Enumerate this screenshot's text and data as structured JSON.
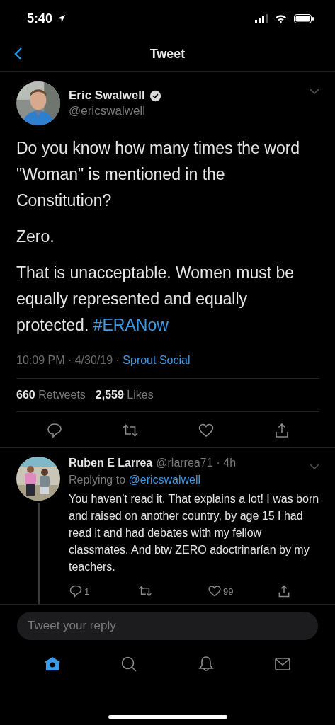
{
  "status_bar": {
    "time": "5:40"
  },
  "nav": {
    "title": "Tweet"
  },
  "tweet": {
    "author": "Eric Swalwell",
    "verified": true,
    "handle": "@ericswalwell",
    "paragraphs": [
      {
        "text": "Do you know how many times the word \"Woman\" is mentioned in the Constitution?"
      },
      {
        "text": "Zero."
      },
      {
        "text": "That is unacceptable. Women must be equally represented and equally protected.",
        "hashtag": "#ERANow"
      }
    ],
    "time": "10:09 PM · 4/30/19 · ",
    "source": "Sprout Social",
    "retweets": "660",
    "retweets_label": "Retweets",
    "likes": "2,559",
    "likes_label": "Likes"
  },
  "reply": {
    "author": "Ruben E Larrea",
    "handle": "@rlarrea71",
    "age": "· 4h",
    "replying_label": "Replying to",
    "replying_handle": "@ericswalwell",
    "text": "You haven’t read it. That explains a lot! I was born and raised on another country, by age 15 I had read it and had debates with my fellow classmates. And btw ZERO adoctrinarían by my teachers.",
    "replies": "1",
    "likes": "99"
  },
  "composer": {
    "placeholder": "Tweet your reply"
  },
  "tab_bar": [
    {
      "kind": "home",
      "selected": true
    },
    {
      "kind": "search",
      "selected": false
    },
    {
      "kind": "notifications",
      "selected": false
    },
    {
      "kind": "messages",
      "selected": false
    }
  ]
}
